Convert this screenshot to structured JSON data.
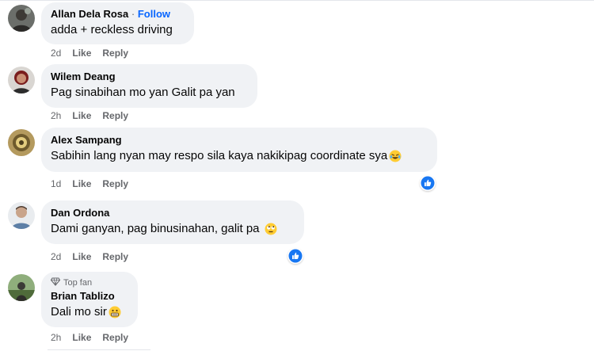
{
  "colors": {
    "bubble_bg": "#f0f2f5",
    "author_text": "#050505",
    "meta_text": "#65676b",
    "follow_blue": "#0866ff",
    "like_blue": "#1877f2"
  },
  "comments": [
    {
      "author": "Allan Dela Rosa",
      "follow_label": "Follow",
      "text": "adda + reckless driving",
      "time": "2d",
      "like_label": "Like",
      "reply_label": "Reply",
      "emoji": "",
      "has_reaction": false
    },
    {
      "author": "Wilem Deang",
      "text": "Pag sinabihan mo yan Galit pa yan",
      "time": "2h",
      "like_label": "Like",
      "reply_label": "Reply",
      "emoji": "",
      "has_reaction": false
    },
    {
      "author": "Alex Sampang",
      "text": "Sabihin lang nyan may respo sila kaya nakikipag coordinate sya",
      "time": "1d",
      "like_label": "Like",
      "reply_label": "Reply",
      "emoji": "laughing-emoji",
      "has_reaction": true,
      "reaction": "like-reaction-icon"
    },
    {
      "author": "Dan Ordona",
      "text": "Dami ganyan, pag binusinahan, galit pa",
      "time": "2d",
      "like_label": "Like",
      "reply_label": "Reply",
      "emoji": "rolling-eyes-emoji",
      "has_reaction": true,
      "reaction": "like-reaction-icon"
    },
    {
      "badge": "Top fan",
      "author": "Brian Tablizo",
      "text": "Dali mo sir",
      "time": "2h",
      "like_label": "Like",
      "reply_label": "Reply",
      "emoji": "grimacing-emoji",
      "has_reaction": false
    }
  ]
}
